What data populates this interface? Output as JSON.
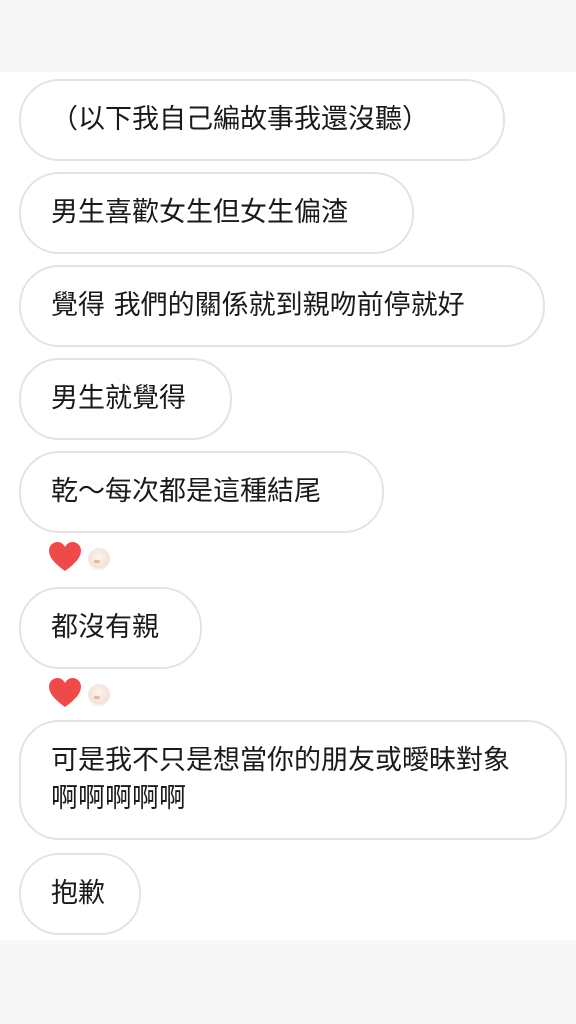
{
  "messages": [
    {
      "text": "（以下我自己編故事我還沒聽）"
    },
    {
      "text": "男生喜歡女生但女生偏渣"
    },
    {
      "text": "覺得 我們的關係就到親吻前停就好"
    },
    {
      "text": "男生就覺得"
    },
    {
      "text": "乾～每次都是這種結尾"
    },
    {
      "text": "都沒有親"
    },
    {
      "text": "可是我不只是想當你的朋友或曖昧對象啊啊啊啊啊"
    },
    {
      "text": "抱歉"
    }
  ],
  "reactions": [
    {
      "icon": "heart-icon",
      "color": "#ef4a4a"
    },
    {
      "icon": "heart-icon",
      "color": "#ef4a4a"
    }
  ]
}
